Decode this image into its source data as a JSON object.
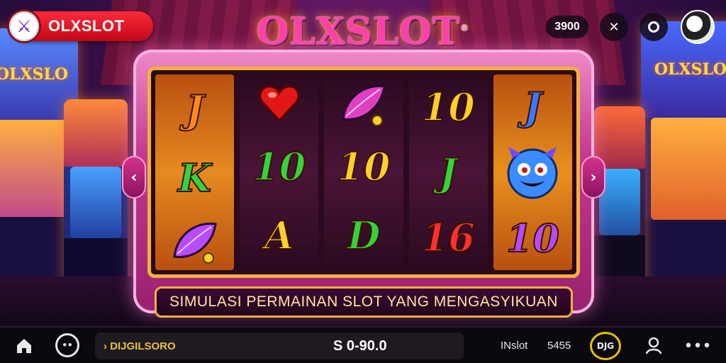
{
  "brand": {
    "name": "OLXSLOT"
  },
  "header": {
    "game_title": "OLXSLOT",
    "trademark": "®",
    "credit_value": "3900"
  },
  "machine": {
    "reels": [
      [
        {
          "kind": "text",
          "text": "J",
          "color": "c-orange",
          "icon": "letter-j-icon"
        },
        {
          "kind": "text",
          "text": "K",
          "color": "c-green",
          "icon": "letter-k-icon"
        },
        {
          "kind": "leaf",
          "color": "#b54cff",
          "icon": "purple-leaf-icon"
        }
      ],
      [
        {
          "kind": "heart",
          "icon": "heart-icon"
        },
        {
          "kind": "text",
          "text": "10",
          "color": "c-green",
          "icon": "number-10-icon"
        },
        {
          "kind": "text",
          "text": "A",
          "color": "c-gold",
          "icon": "letter-a-icon"
        }
      ],
      [
        {
          "kind": "leaf",
          "color": "#e040c0",
          "icon": "pink-leaf-icon"
        },
        {
          "kind": "text",
          "text": "10",
          "color": "c-gold",
          "icon": "number-10-icon"
        },
        {
          "kind": "text",
          "text": "D",
          "color": "c-green",
          "icon": "letter-d-icon"
        }
      ],
      [
        {
          "kind": "text",
          "text": "10",
          "color": "c-gold",
          "icon": "number-10-icon"
        },
        {
          "kind": "text",
          "text": "J",
          "color": "c-green",
          "icon": "letter-j-icon"
        },
        {
          "kind": "text",
          "text": "16",
          "color": "c-red",
          "icon": "number-16-icon"
        }
      ],
      [
        {
          "kind": "text",
          "text": "J",
          "color": "c-blue",
          "icon": "letter-j-icon"
        },
        {
          "kind": "monster",
          "icon": "blue-monster-icon"
        },
        {
          "kind": "text",
          "text": "10",
          "color": "c-purple",
          "icon": "number-10-icon"
        }
      ]
    ],
    "banner": "SIMULASI PERMAINAN SLOT YANG MENGASYIKUAN"
  },
  "bottom_bar": {
    "menu_label": "› DIJGILSORO",
    "bet_label": "S 0-90.0",
    "status_label": "INslot",
    "count_value": "5455",
    "spin_label": "DJG"
  },
  "colors": {
    "brand_red": "#e0101e",
    "title_pink": "#ff3fa8",
    "frame_gold": "#f2b040",
    "spin_ring": "#e6c200"
  }
}
